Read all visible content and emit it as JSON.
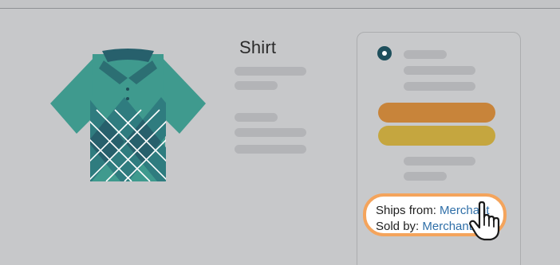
{
  "product": {
    "title": "Shirt"
  },
  "seller_info": {
    "ships_from_label": "Ships from:",
    "ships_from_value": "Merchant",
    "sold_by_label": "Sold by:",
    "sold_by_value": "Merchant"
  },
  "icons": {
    "shirt": "shirt-icon",
    "cursor": "hand-pointer-icon",
    "radio": "radio-selected-icon"
  },
  "colors": {
    "background": "#c7c8ca",
    "shirt_teal": "#3f9a8e",
    "shirt_dark": "#27606c",
    "add_to_cart": "#c8843a",
    "buy_now": "#c5a63f",
    "highlight_ring": "#f4a45c",
    "link": "#2f6fa8"
  }
}
